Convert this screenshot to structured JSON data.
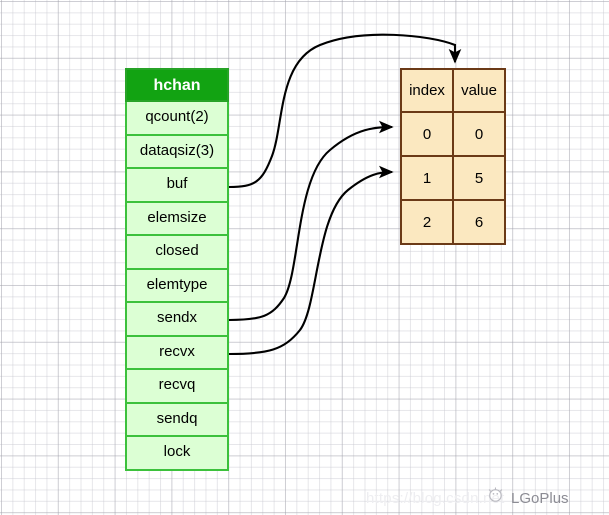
{
  "diagram": {
    "struct": {
      "title": "hchan",
      "fields": [
        {
          "label": "qcount(2)"
        },
        {
          "label": "dataqsiz(3)"
        },
        {
          "label": "buf"
        },
        {
          "label": "elemsize"
        },
        {
          "label": "closed"
        },
        {
          "label": "elemtype"
        },
        {
          "label": "sendx"
        },
        {
          "label": "recvx"
        },
        {
          "label": "recvq"
        },
        {
          "label": "sendq"
        },
        {
          "label": "lock"
        }
      ],
      "header_bg": "#12a312",
      "header_text_color": "#ffffff",
      "row_bg": "#dcffd4",
      "border_color": "#3cc13c"
    },
    "buffer_table": {
      "columns": [
        "index",
        "value"
      ],
      "rows": [
        {
          "index": "0",
          "value": "0",
          "value_highlight": true
        },
        {
          "index": "1",
          "value": "5",
          "value_highlight": false
        },
        {
          "index": "2",
          "value": "6",
          "value_highlight": false
        }
      ],
      "cell_bg": "#fbe8c0",
      "border_color": "#6b3a17",
      "highlight_color": "#7eb8e8"
    },
    "connectors": [
      {
        "from": "buf",
        "to": "buffer-table-top"
      },
      {
        "from": "sendx",
        "to": "buffer-row-0"
      },
      {
        "from": "recvx",
        "to": "buffer-row-1"
      }
    ]
  },
  "watermark": {
    "url": "https://blog.csdn.net",
    "badge_label": "LGoPlus"
  }
}
